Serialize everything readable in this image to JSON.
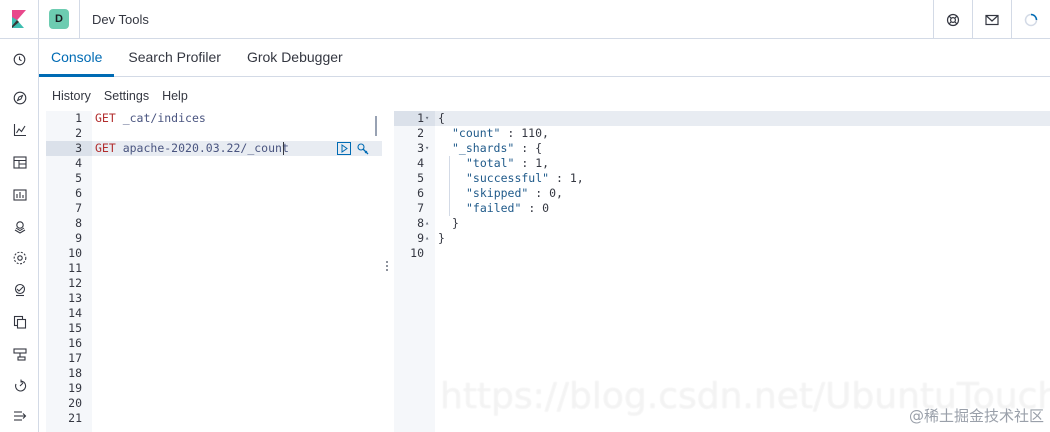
{
  "header": {
    "space_initial": "D",
    "app_title": "Dev Tools",
    "icons": [
      "help-icon",
      "mail-icon",
      "loading-spinner-icon"
    ]
  },
  "sidenav": {
    "icons": [
      "clock-icon",
      "compass-icon",
      "visualize-icon",
      "dashboard-icon",
      "canvas-icon",
      "maps-icon",
      "ml-icon",
      "infra-icon",
      "logs-icon",
      "uptime-icon",
      "devtools-icon",
      "monitoring-icon",
      "collapse-icon"
    ]
  },
  "tabs": [
    {
      "label": "Console",
      "active": true
    },
    {
      "label": "Search Profiler",
      "active": false
    },
    {
      "label": "Grok Debugger",
      "active": false
    }
  ],
  "submenu": [
    "History",
    "Settings",
    "Help"
  ],
  "editor": {
    "line_numbers": [
      "1",
      "2",
      "3",
      "4",
      "5",
      "6",
      "7",
      "8",
      "9",
      "10",
      "11",
      "12",
      "13",
      "14",
      "15",
      "16",
      "17",
      "18",
      "19",
      "20",
      "21"
    ],
    "line1_method": "GET",
    "line1_path": " _cat/indices",
    "line3_method": "GET",
    "line3_path": " apache-2020.03.22/_count"
  },
  "output": {
    "line_numbers": [
      "1",
      "2",
      "3",
      "4",
      "5",
      "6",
      "7",
      "8",
      "9",
      "10"
    ],
    "lines": [
      {
        "text": "{"
      },
      {
        "key": "\"count\"",
        "rest": " : 110,"
      },
      {
        "key": "\"_shards\"",
        "rest": " : {"
      },
      {
        "key": "\"total\"",
        "rest": " : 1,"
      },
      {
        "key": "\"successful\"",
        "rest": " : 1,"
      },
      {
        "key": "\"skipped\"",
        "rest": " : 0,"
      },
      {
        "key": "\"failed\"",
        "rest": " : 0"
      },
      {
        "text": "}"
      },
      {
        "text": "}"
      },
      {
        "text": ""
      }
    ]
  },
  "watermark": {
    "url": "https://blog.csdn.net/UbuntuTouch",
    "site": "@稀土掘金技术社区"
  },
  "colors": {
    "accent": "#006bb4",
    "method": "#b22d2d",
    "json_key": "#1f5a8a",
    "space_avatar": "#6dccb1"
  }
}
